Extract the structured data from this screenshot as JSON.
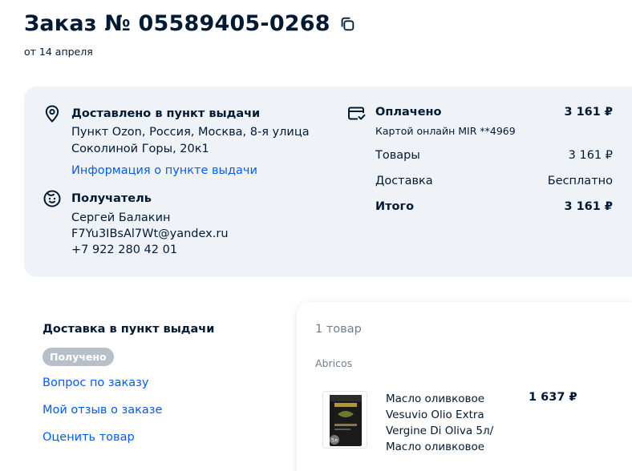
{
  "order": {
    "title": "Заказ № 05589405-0268",
    "date": "от 14 апреля"
  },
  "delivery": {
    "status": "Доставлено в пункт выдачи",
    "address_line1": "Пункт Ozon, Россия, Москва, 8-я улица",
    "address_line2": "Соколиной Горы, 20к1",
    "pickup_info_link": "Информация о пункте выдачи"
  },
  "recipient": {
    "heading": "Получатель",
    "name": "Сергей Балакин",
    "email": "F7Yu3IBsAl7Wt@yandex.ru",
    "phone": "+7 922 280 42 01"
  },
  "payment": {
    "status": "Оплачено",
    "status_amount": "3 161 ₽",
    "method": "Картой онлайн MIR **4969",
    "goods_label": "Товары",
    "goods_amount": "3 161 ₽",
    "shipping_label": "Доставка",
    "shipping_value": "Бесплатно",
    "total_label": "Итого",
    "total_amount": "3 161 ₽"
  },
  "left_panel": {
    "title": "Доставка в пункт выдачи",
    "badge": "Получено",
    "links": [
      "Вопрос по заказу",
      "Мой отзыв о заказе",
      "Оценить товар"
    ]
  },
  "items": {
    "count_label": "1 товар",
    "seller": "Abricos",
    "products": [
      {
        "name": "Масло оливковое Vesuvio Olio Extra Vergine Di Oliva 5л/ Масло оливковое",
        "price": "1 637 ₽",
        "badge": "5л"
      }
    ]
  },
  "colors": {
    "link": "#005bff",
    "card_bg": "#eff3f8",
    "badge_bg": "#b7bfc9",
    "text": "#001a34"
  },
  "icons": [
    "copy-icon",
    "location-pin-icon",
    "face-icon",
    "card-icon"
  ]
}
